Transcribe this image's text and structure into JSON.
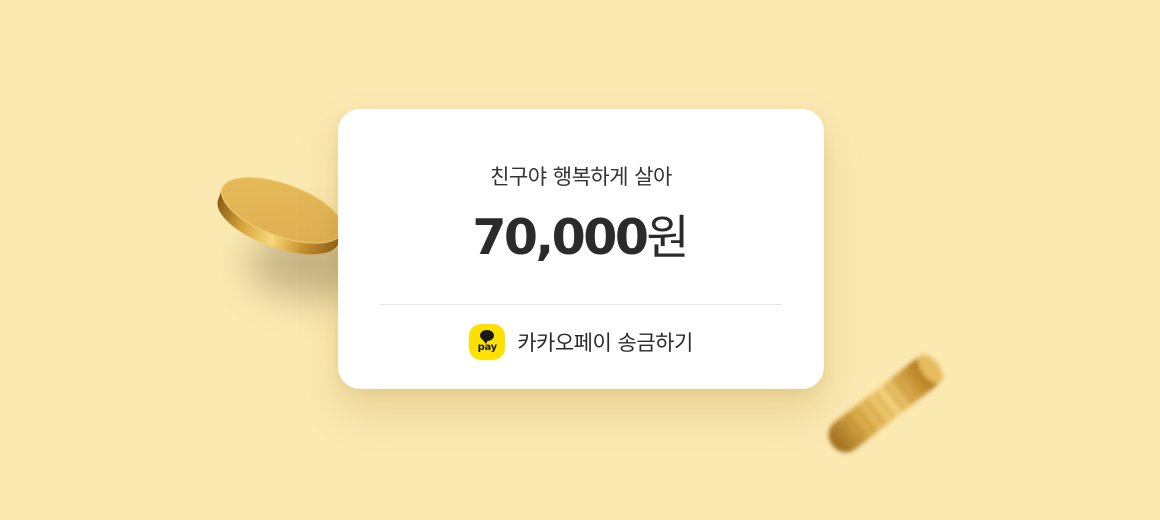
{
  "card": {
    "message": "친구야 행복하게 살아",
    "amount_number": "70,000",
    "amount_unit": "원"
  },
  "payment": {
    "badge_text": "pay",
    "label": "카카오페이 송금하기"
  },
  "colors": {
    "background": "#fbe9b2",
    "card": "#ffffff",
    "kakaopay_yellow": "#ffe100",
    "coin_gold": "#e0b24c"
  },
  "icons": {
    "payment_badge": "kakaopay-icon",
    "decoration_left": "gold-coin-icon",
    "decoration_right": "gold-coin-icon"
  }
}
